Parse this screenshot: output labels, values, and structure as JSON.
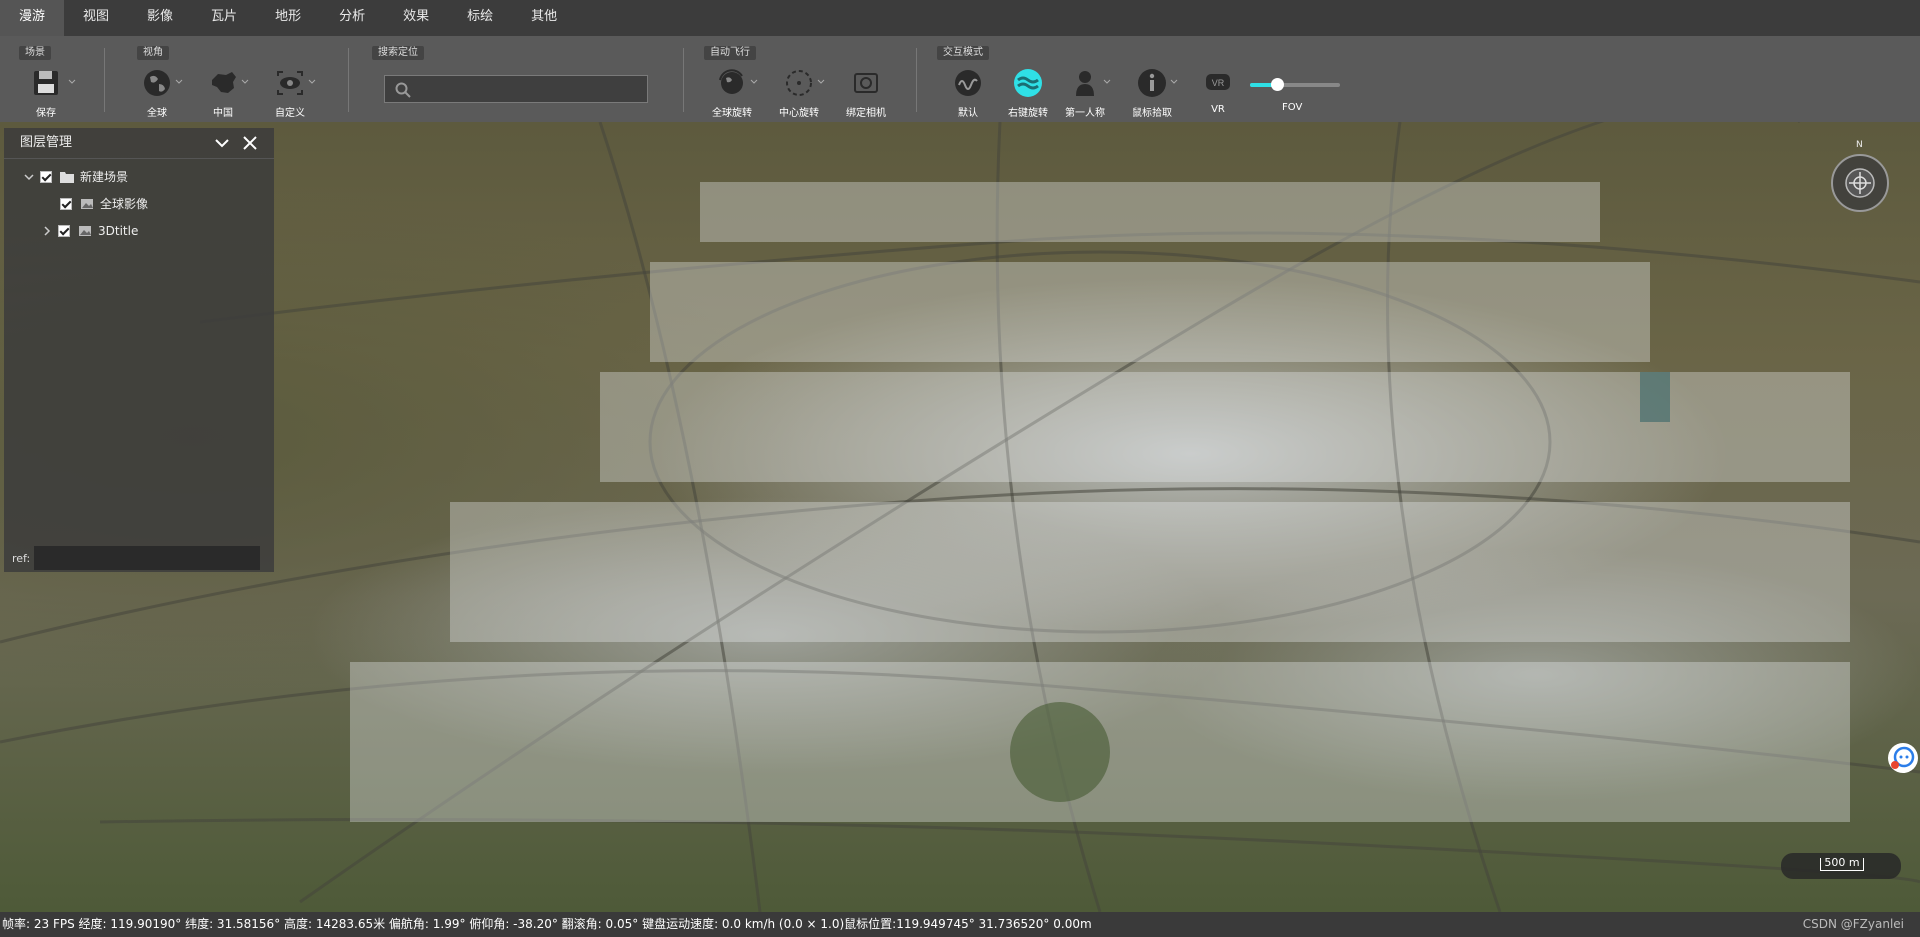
{
  "menu": [
    {
      "label": "漫游",
      "active": true
    },
    {
      "label": "视图"
    },
    {
      "label": "影像"
    },
    {
      "label": "瓦片"
    },
    {
      "label": "地形"
    },
    {
      "label": "分析"
    },
    {
      "label": "效果"
    },
    {
      "label": "标绘"
    },
    {
      "label": "其他"
    }
  ],
  "ribbon": {
    "groups": {
      "scene": "场景",
      "view": "视角",
      "search": "搜索定位",
      "autofly": "自动飞行",
      "interaction": "交互模式"
    },
    "tools": {
      "save": "保存",
      "globe": "全球",
      "china": "中国",
      "custom": "自定义",
      "global_rotate": "全球旋转",
      "center_rotate": "中心旋转",
      "bind_camera": "绑定相机",
      "default": "默认",
      "right_rotate": "右键旋转",
      "first_person": "第一人称",
      "mouse_pick": "鼠标拾取",
      "vr": "VR",
      "fov": "FOV"
    },
    "search_value": "",
    "fov_level": 0.3,
    "accent": "#2fe0e6"
  },
  "layer_panel": {
    "title": "图层管理",
    "tree": {
      "root": "新建场景",
      "imagery": "全球影像",
      "tiles": "3Dtitle"
    },
    "ref_label": "ref:",
    "ref_value": ""
  },
  "map": {
    "compass_letter": "N",
    "scale_label": "500 m"
  },
  "status": {
    "text": "帧率: 23 FPS 经度: 119.90190° 纬度: 31.58156° 高度: 14283.65米 偏航角: 1.99° 俯仰角: -38.20° 翻滚角: 0.05° 键盘运动速度: 0.0 km/h (0.0 × 1.0)鼠标位置:119.949745° 31.736520° 0.00m",
    "watermark": "CSDN @FZyanlei"
  }
}
